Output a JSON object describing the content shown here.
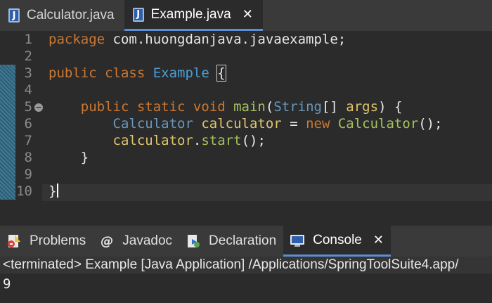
{
  "editor_tabs": [
    {
      "label": "Calculator.java",
      "icon": "java-file-icon"
    },
    {
      "label": "Example.java",
      "icon": "java-file-icon",
      "close": "✕"
    }
  ],
  "code_lines": [
    {
      "num": "1",
      "tokens": [
        [
          "kw",
          "package "
        ],
        [
          "plain",
          "com.huongdanjava.javaexample;"
        ]
      ]
    },
    {
      "num": "2",
      "tokens": []
    },
    {
      "num": "3",
      "tokens": [
        [
          "kw",
          "public class "
        ],
        [
          "cls",
          "Example "
        ],
        [
          "brace",
          "{"
        ]
      ]
    },
    {
      "num": "4",
      "tokens": []
    },
    {
      "num": "5",
      "tokens": [
        [
          "plain",
          "    "
        ],
        [
          "kw",
          "public static void "
        ],
        [
          "fn",
          "main"
        ],
        [
          "plain",
          "("
        ],
        [
          "type",
          "String"
        ],
        [
          "plain",
          "[] "
        ],
        [
          "var",
          "args"
        ],
        [
          "plain",
          ") {"
        ]
      ]
    },
    {
      "num": "6",
      "tokens": [
        [
          "plain",
          "        "
        ],
        [
          "type",
          "Calculator "
        ],
        [
          "var",
          "calculator"
        ],
        [
          "plain",
          " = "
        ],
        [
          "kw",
          "new "
        ],
        [
          "fn",
          "Calculator"
        ],
        [
          "plain",
          "();"
        ]
      ]
    },
    {
      "num": "7",
      "tokens": [
        [
          "plain",
          "        "
        ],
        [
          "var",
          "calculator"
        ],
        [
          "plain",
          "."
        ],
        [
          "fn",
          "start"
        ],
        [
          "plain",
          "();"
        ]
      ]
    },
    {
      "num": "8",
      "tokens": [
        [
          "plain",
          "    }"
        ]
      ]
    },
    {
      "num": "9",
      "tokens": []
    },
    {
      "num": "10",
      "tokens": [
        [
          "plain",
          "}"
        ]
      ]
    }
  ],
  "view_tabs": [
    {
      "label": "Problems",
      "icon": "problems-icon"
    },
    {
      "label": "Javadoc",
      "icon": "javadoc-at-icon",
      "glyph": "@"
    },
    {
      "label": "Declaration",
      "icon": "declaration-icon"
    },
    {
      "label": "Console",
      "icon": "console-icon",
      "close": "✕"
    }
  ],
  "console": {
    "status": "<terminated> Example [Java Application] /Applications/SpringToolSuite4.app/",
    "output": "9"
  },
  "colors": {
    "keyword": "#cc7832",
    "type": "#6897bb",
    "class": "#4a9fd8",
    "method": "#a5c25c",
    "variable": "#e0c46c",
    "accent": "#5b8ed6"
  }
}
